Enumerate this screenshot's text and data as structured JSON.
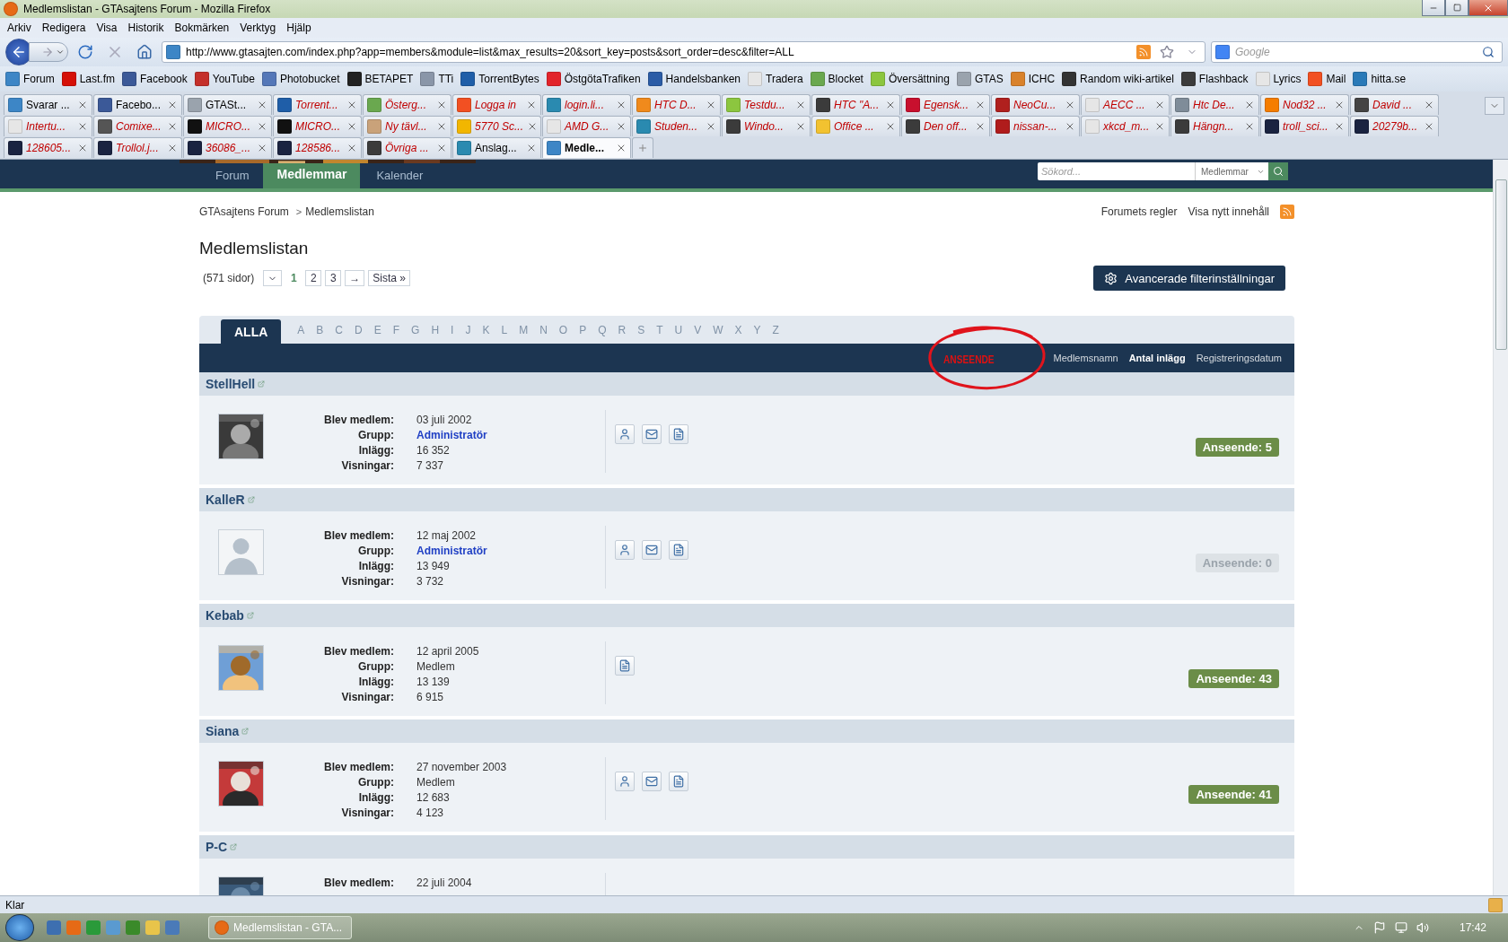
{
  "window": {
    "title": "Medlemslistan - GTAsajtens Forum - Mozilla Firefox"
  },
  "menu": [
    "Arkiv",
    "Redigera",
    "Visa",
    "Historik",
    "Bokmärken",
    "Verktyg",
    "Hjälp"
  ],
  "address": {
    "value": "http://www.gtasajten.com/index.php?app=members&module=list&max_results=20&sort_key=posts&sort_order=desc&filter=ALL"
  },
  "web_search": {
    "placeholder": "Google"
  },
  "bookmarks": [
    {
      "label": "Forum",
      "color": "#3d86c6"
    },
    {
      "label": "Last.fm",
      "color": "#d51007"
    },
    {
      "label": "Facebook",
      "color": "#3b5998"
    },
    {
      "label": "YouTube",
      "color": "#c4302b"
    },
    {
      "label": "Photobucket",
      "color": "#5477b8"
    },
    {
      "label": "BETAPET",
      "color": "#222222"
    },
    {
      "label": "TTi",
      "color": "#8a96a8"
    },
    {
      "label": "TorrentBytes",
      "color": "#1f5ea8"
    },
    {
      "label": "ÖstgötaTrafiken",
      "color": "#e2242b"
    },
    {
      "label": "Handelsbanken",
      "color": "#2b5ca6"
    },
    {
      "label": "Tradera",
      "color": "#e6e6e6"
    },
    {
      "label": "Blocket",
      "color": "#6aa84f"
    },
    {
      "label": "Översättning",
      "color": "#8cc63f"
    },
    {
      "label": "GTAS",
      "color": "#9aa3ad"
    },
    {
      "label": "ICHC",
      "color": "#d9822b"
    },
    {
      "label": "Random wiki-artikel",
      "color": "#333333"
    },
    {
      "label": "Flashback",
      "color": "#3b3b3b"
    },
    {
      "label": "Lyrics",
      "color": "#e6e6e6"
    },
    {
      "label": "Mail",
      "color": "#f25022"
    },
    {
      "label": "hitta.se",
      "color": "#2a7ab8"
    }
  ],
  "tab_rows": [
    {
      "tabs": [
        {
          "label": "Svarar ...",
          "selected": false,
          "unloaded": false,
          "color": "#3d86c6"
        },
        {
          "label": "Facebo...",
          "selected": false,
          "unloaded": false,
          "color": "#3b5998"
        },
        {
          "label": "GTASt...",
          "selected": false,
          "unloaded": false,
          "color": "#9aa3ad"
        },
        {
          "label": "Torrent...",
          "selected": false,
          "unloaded": true,
          "color": "#1f5ea8"
        },
        {
          "label": "Österg...",
          "selected": false,
          "unloaded": true,
          "color": "#6aa84f"
        },
        {
          "label": "Logga in",
          "selected": false,
          "unloaded": true,
          "color": "#f25022"
        },
        {
          "label": "login.li...",
          "selected": false,
          "unloaded": true,
          "color": "#2a8ab0"
        },
        {
          "label": "HTC D...",
          "selected": false,
          "unloaded": true,
          "color": "#f08a1c"
        },
        {
          "label": "Testdu...",
          "selected": false,
          "unloaded": true,
          "color": "#8cc63f"
        },
        {
          "label": "HTC \"A...",
          "selected": false,
          "unloaded": true,
          "color": "#3b3b3b"
        },
        {
          "label": "Egensk...",
          "selected": false,
          "unloaded": true,
          "color": "#c8102e"
        },
        {
          "label": "NeoCu...",
          "selected": false,
          "unloaded": true,
          "color": "#b0201e"
        },
        {
          "label": "AECC ...",
          "selected": false,
          "unloaded": true,
          "color": "#e6e6e6"
        },
        {
          "label": "Htc De...",
          "selected": false,
          "unloaded": true,
          "color": "#7f8c99"
        },
        {
          "label": "Nod32 ...",
          "selected": false,
          "unloaded": true,
          "color": "#f57d00"
        },
        {
          "label": "David ...",
          "selected": false,
          "unloaded": true,
          "color": "#444444"
        }
      ]
    },
    {
      "tabs": [
        {
          "label": "Intertu...",
          "selected": false,
          "unloaded": true,
          "color": "#e6e6e6"
        },
        {
          "label": "Comixe...",
          "selected": false,
          "unloaded": true,
          "color": "#555555"
        },
        {
          "label": "MICRO...",
          "selected": false,
          "unloaded": true,
          "color": "#111111"
        },
        {
          "label": "MICRO...",
          "selected": false,
          "unloaded": true,
          "color": "#111111"
        },
        {
          "label": "Ny tävl...",
          "selected": false,
          "unloaded": true,
          "color": "#c9a27a"
        },
        {
          "label": "5770 Sc...",
          "selected": false,
          "unloaded": true,
          "color": "#f2b600"
        },
        {
          "label": "AMD G...",
          "selected": false,
          "unloaded": true,
          "color": "#e6e6e6"
        },
        {
          "label": "Studen...",
          "selected": false,
          "unloaded": true,
          "color": "#2a8ab0"
        },
        {
          "label": "Windo...",
          "selected": false,
          "unloaded": true,
          "color": "#3b3b3b"
        },
        {
          "label": "Office ...",
          "selected": false,
          "unloaded": true,
          "color": "#f2c230"
        },
        {
          "label": "Den off...",
          "selected": false,
          "unloaded": true,
          "color": "#3b3b3b"
        },
        {
          "label": "nissan-...",
          "selected": false,
          "unloaded": true,
          "color": "#b01c1c"
        },
        {
          "label": "xkcd_m...",
          "selected": false,
          "unloaded": true,
          "color": "#e6e6e6"
        },
        {
          "label": "Hängn...",
          "selected": false,
          "unloaded": true,
          "color": "#3b3b3b"
        },
        {
          "label": "troll_sci...",
          "selected": false,
          "unloaded": true,
          "color": "#1a2340"
        },
        {
          "label": "20279b...",
          "selected": false,
          "unloaded": true,
          "color": "#1a2340"
        }
      ]
    },
    {
      "tabs": [
        {
          "label": "128605...",
          "selected": false,
          "unloaded": true,
          "color": "#1a2340"
        },
        {
          "label": "Trollol.j...",
          "selected": false,
          "unloaded": true,
          "color": "#1a2340"
        },
        {
          "label": "36086_...",
          "selected": false,
          "unloaded": true,
          "color": "#1a2340"
        },
        {
          "label": "128586...",
          "selected": false,
          "unloaded": true,
          "color": "#1a2340"
        },
        {
          "label": "Övriga ...",
          "selected": false,
          "unloaded": true,
          "color": "#3b3b3b"
        },
        {
          "label": "Anslag...",
          "selected": false,
          "unloaded": false,
          "color": "#2a8ab0"
        },
        {
          "label": "Medle...",
          "selected": true,
          "unloaded": false,
          "color": "#3d86c6"
        }
      ]
    }
  ],
  "site_nav": {
    "items": [
      {
        "label": "Forum",
        "selected": false
      },
      {
        "label": "Medlemmar",
        "selected": true
      },
      {
        "label": "Kalender",
        "selected": false
      }
    ],
    "search": {
      "placeholder": "Sökord...",
      "scope": "Medlemmar"
    }
  },
  "breadcrumb": {
    "items": [
      "GTAsajtens Forum",
      "Medlemslistan"
    ],
    "separator": ">"
  },
  "header_links": [
    "Forumets regler",
    "Visa nytt innehåll"
  ],
  "heading": "Medlemslistan",
  "pagination": {
    "summary": "(571 sidor)",
    "pages": [
      {
        "label": "1",
        "selected": true
      },
      {
        "label": "2",
        "selected": false
      },
      {
        "label": "3",
        "selected": false
      }
    ],
    "next": "→",
    "last": "Sista »"
  },
  "filter_button": "Avancerade filterinställningar",
  "letters": [
    {
      "label": "ALLA",
      "selected": true
    },
    {
      "label": "A",
      "selected": false
    },
    {
      "label": "B",
      "selected": false
    },
    {
      "label": "C",
      "selected": false
    },
    {
      "label": "D",
      "selected": false
    },
    {
      "label": "E",
      "selected": false
    },
    {
      "label": "F",
      "selected": false
    },
    {
      "label": "G",
      "selected": false
    },
    {
      "label": "H",
      "selected": false
    },
    {
      "label": "I",
      "selected": false
    },
    {
      "label": "J",
      "selected": false
    },
    {
      "label": "K",
      "selected": false
    },
    {
      "label": "L",
      "selected": false
    },
    {
      "label": "M",
      "selected": false
    },
    {
      "label": "N",
      "selected": false
    },
    {
      "label": "O",
      "selected": false
    },
    {
      "label": "P",
      "selected": false
    },
    {
      "label": "Q",
      "selected": false
    },
    {
      "label": "R",
      "selected": false
    },
    {
      "label": "S",
      "selected": false
    },
    {
      "label": "T",
      "selected": false
    },
    {
      "label": "U",
      "selected": false
    },
    {
      "label": "V",
      "selected": false
    },
    {
      "label": "W",
      "selected": false
    },
    {
      "label": "X",
      "selected": false
    },
    {
      "label": "Y",
      "selected": false
    },
    {
      "label": "Z",
      "selected": false
    }
  ],
  "sort_options": [
    {
      "label": "Medlemsnamn",
      "selected": false
    },
    {
      "label": "Antal inlägg",
      "selected": true
    },
    {
      "label": "Registreringsdatum",
      "selected": false
    }
  ],
  "annotation": {
    "text": "ANSEENDE"
  },
  "members": [
    {
      "name": "StellHell",
      "avatar": {
        "kind": "picture"
      },
      "fields": [
        {
          "label": "Blev medlem:",
          "value": "03 juli 2002",
          "kind": "text"
        },
        {
          "label": "Grupp:",
          "value": "Administratör",
          "kind": "link"
        },
        {
          "label": "Inlägg:",
          "value": "16 352",
          "kind": "text"
        },
        {
          "label": "Visningar:",
          "value": "7 337",
          "kind": "text"
        }
      ],
      "actions": [
        {
          "kind": "profile"
        },
        {
          "kind": "message"
        },
        {
          "kind": "content"
        }
      ],
      "reputation": {
        "text": "Anseende: 5",
        "muted": false
      }
    },
    {
      "name": "KalleR",
      "avatar": {
        "kind": "default"
      },
      "fields": [
        {
          "label": "Blev medlem:",
          "value": "12 maj 2002",
          "kind": "text"
        },
        {
          "label": "Grupp:",
          "value": "Administratör",
          "kind": "link"
        },
        {
          "label": "Inlägg:",
          "value": "13 949",
          "kind": "text"
        },
        {
          "label": "Visningar:",
          "value": "3 732",
          "kind": "text"
        }
      ],
      "actions": [
        {
          "kind": "profile"
        },
        {
          "kind": "message"
        },
        {
          "kind": "content"
        }
      ],
      "reputation": {
        "text": "Anseende: 0",
        "muted": true
      }
    },
    {
      "name": "Kebab",
      "avatar": {
        "kind": "picture"
      },
      "fields": [
        {
          "label": "Blev medlem:",
          "value": "12 april 2005",
          "kind": "text"
        },
        {
          "label": "Grupp:",
          "value": "Medlem",
          "kind": "text"
        },
        {
          "label": "Inlägg:",
          "value": "13 139",
          "kind": "text"
        },
        {
          "label": "Visningar:",
          "value": "6 915",
          "kind": "text"
        }
      ],
      "actions": [
        {
          "kind": "content"
        }
      ],
      "reputation": {
        "text": "Anseende: 43",
        "muted": false
      }
    },
    {
      "name": "Siana",
      "avatar": {
        "kind": "picture"
      },
      "fields": [
        {
          "label": "Blev medlem:",
          "value": "27 november 2003",
          "kind": "text"
        },
        {
          "label": "Grupp:",
          "value": "Medlem",
          "kind": "text"
        },
        {
          "label": "Inlägg:",
          "value": "12 683",
          "kind": "text"
        },
        {
          "label": "Visningar:",
          "value": "4 123",
          "kind": "text"
        }
      ],
      "actions": [
        {
          "kind": "profile"
        },
        {
          "kind": "message"
        },
        {
          "kind": "content"
        }
      ],
      "reputation": {
        "text": "Anseende: 41",
        "muted": false
      }
    },
    {
      "name": "P-C",
      "avatar": {
        "kind": "picture"
      },
      "fields": [
        {
          "label": "Blev medlem:",
          "value": "22 juli 2004",
          "kind": "text"
        }
      ]
    }
  ],
  "status_bar": {
    "text": "Klar"
  },
  "taskbar": {
    "task": "Medlemslistan - GTA...",
    "time": "17:42"
  }
}
